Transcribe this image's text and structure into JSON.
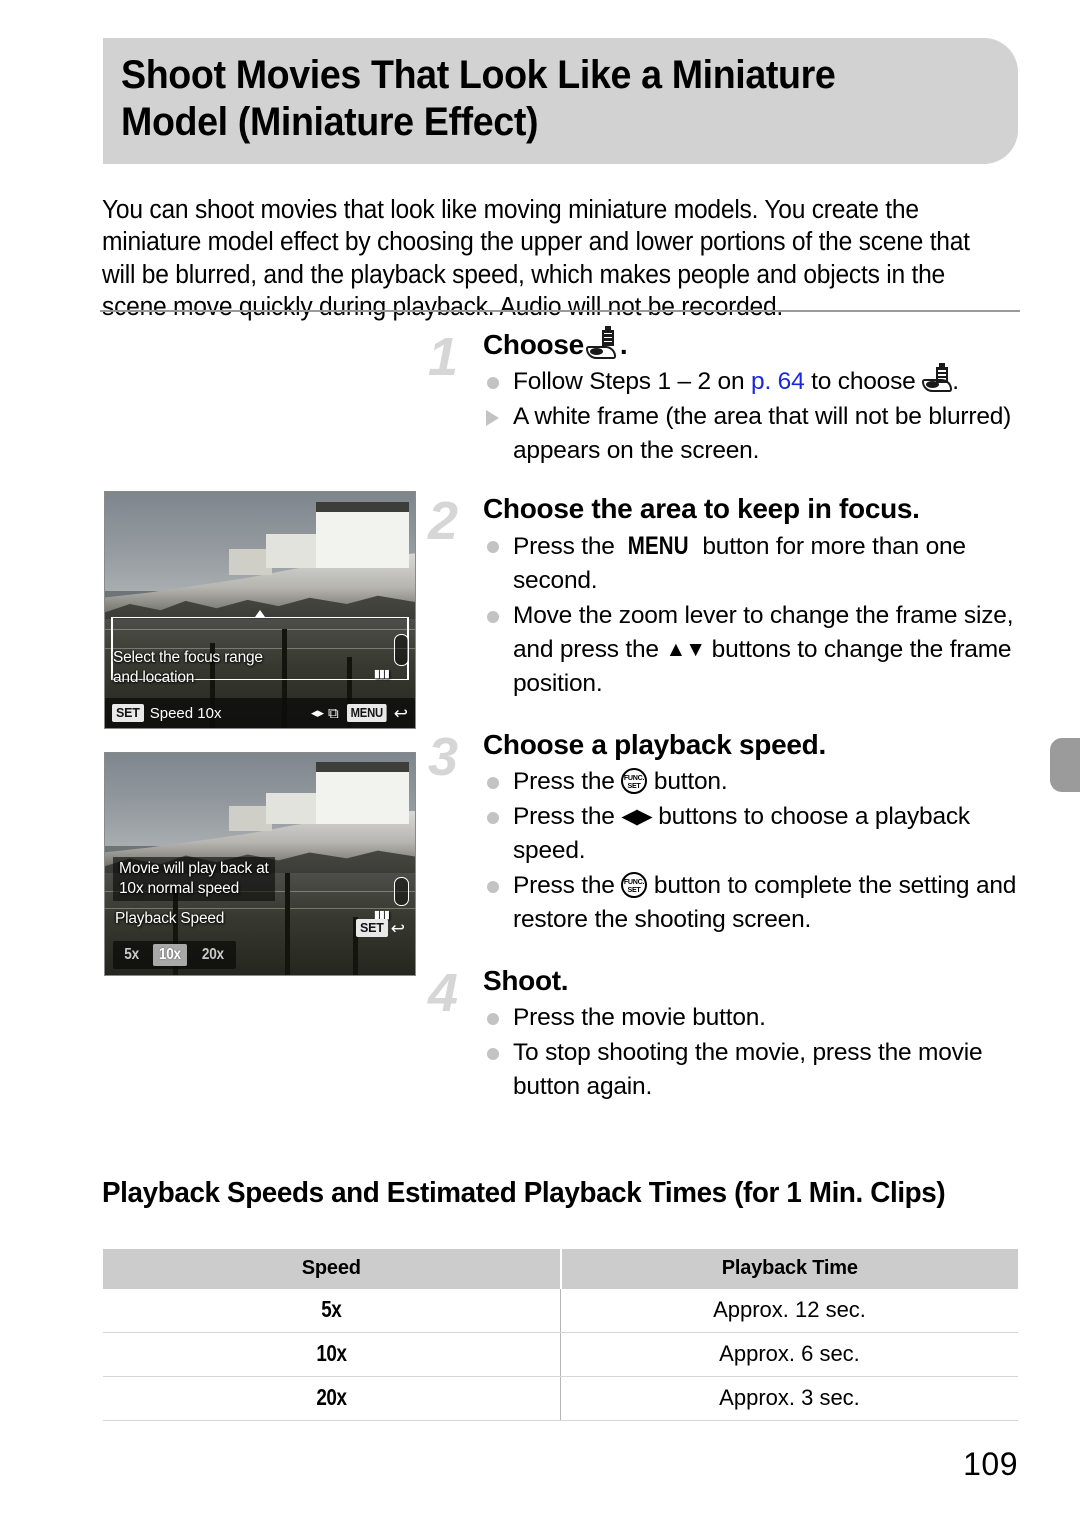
{
  "page": {
    "title": "Shoot Movies That Look Like a Miniature Model (Miniature Effect)",
    "number": "109"
  },
  "intro": "You can shoot movies that look like moving miniature models. You create the miniature model effect by choosing the upper and lower portions of the scene that will be blurred, and the playback speed, which makes people and objects in the scene move quickly during playback. Audio will not be recorded.",
  "steps": [
    {
      "number": "1",
      "heading_before": "Choose",
      "heading_after": ".",
      "bullets": [
        {
          "marker": "dot",
          "parts": [
            "Follow Steps 1 – 2 on ",
            "p. 64",
            " to choose ",
            "."
          ]
        },
        {
          "marker": "triangle",
          "text": "A white frame (the area that will not be blurred) appears on the screen."
        }
      ]
    },
    {
      "number": "2",
      "heading": "Choose the area to keep in focus.",
      "bullets": [
        {
          "marker": "dot",
          "before": "Press the ",
          "key": "MENU",
          "after": " button for more than one second."
        },
        {
          "marker": "dot",
          "before": "Move the zoom lever to change the frame size, and press the ",
          "arrows": "▲▼",
          "after": " buttons to change the frame position."
        }
      ]
    },
    {
      "number": "3",
      "heading": "Choose a playback speed.",
      "bullets": [
        {
          "marker": "dot",
          "before": "Press the ",
          "icon": "func-set",
          "after": " button."
        },
        {
          "marker": "dot",
          "before": "Press the ",
          "arrows": "◀▶",
          "after": " buttons to choose a playback speed."
        },
        {
          "marker": "dot",
          "before": "Press the ",
          "icon": "func-set",
          "after": " button to complete the setting and restore the shooting screen."
        }
      ]
    },
    {
      "number": "4",
      "heading": "Shoot.",
      "bullets": [
        {
          "marker": "dot",
          "text": "Press the movie button."
        },
        {
          "marker": "dot",
          "text": "To stop shooting the movie, press the movie button again."
        }
      ]
    }
  ],
  "screens": {
    "one": {
      "message": "Select the focus range\nand location",
      "set_chip": "SET",
      "speed_label": "Speed 10x",
      "lr_arrows": "◂▸",
      "swap_icon": "⧉",
      "menu_chip": "MENU",
      "return_glyph": "↩"
    },
    "two": {
      "message": "Movie will play back at\n10x normal speed",
      "panel_label": "Playback Speed",
      "options": [
        "5x",
        "10x",
        "20x"
      ],
      "selected": "10x",
      "set_chip": "SET",
      "return_glyph": "↩"
    }
  },
  "subheading": "Playback Speeds and Estimated Playback Times (for 1 Min. Clips)",
  "chart_data": {
    "type": "table",
    "title": "Playback Speeds and Estimated Playback Times (for 1 Min. Clips)",
    "columns": [
      "Speed",
      "Playback Time"
    ],
    "rows": [
      [
        "5x",
        "Approx. 12 sec."
      ],
      [
        "10x",
        "Approx. 6 sec."
      ],
      [
        "20x",
        "Approx. 3 sec."
      ]
    ]
  },
  "colors": {
    "banner_gray": "#d2d2d2",
    "step_number_gray": "#d6d6d6",
    "bullet_gray": "#c3c3c3",
    "link_blue": "#1a27e0",
    "table_header_gray": "#cccccc",
    "edge_tab_gray": "#9b9b9b"
  }
}
